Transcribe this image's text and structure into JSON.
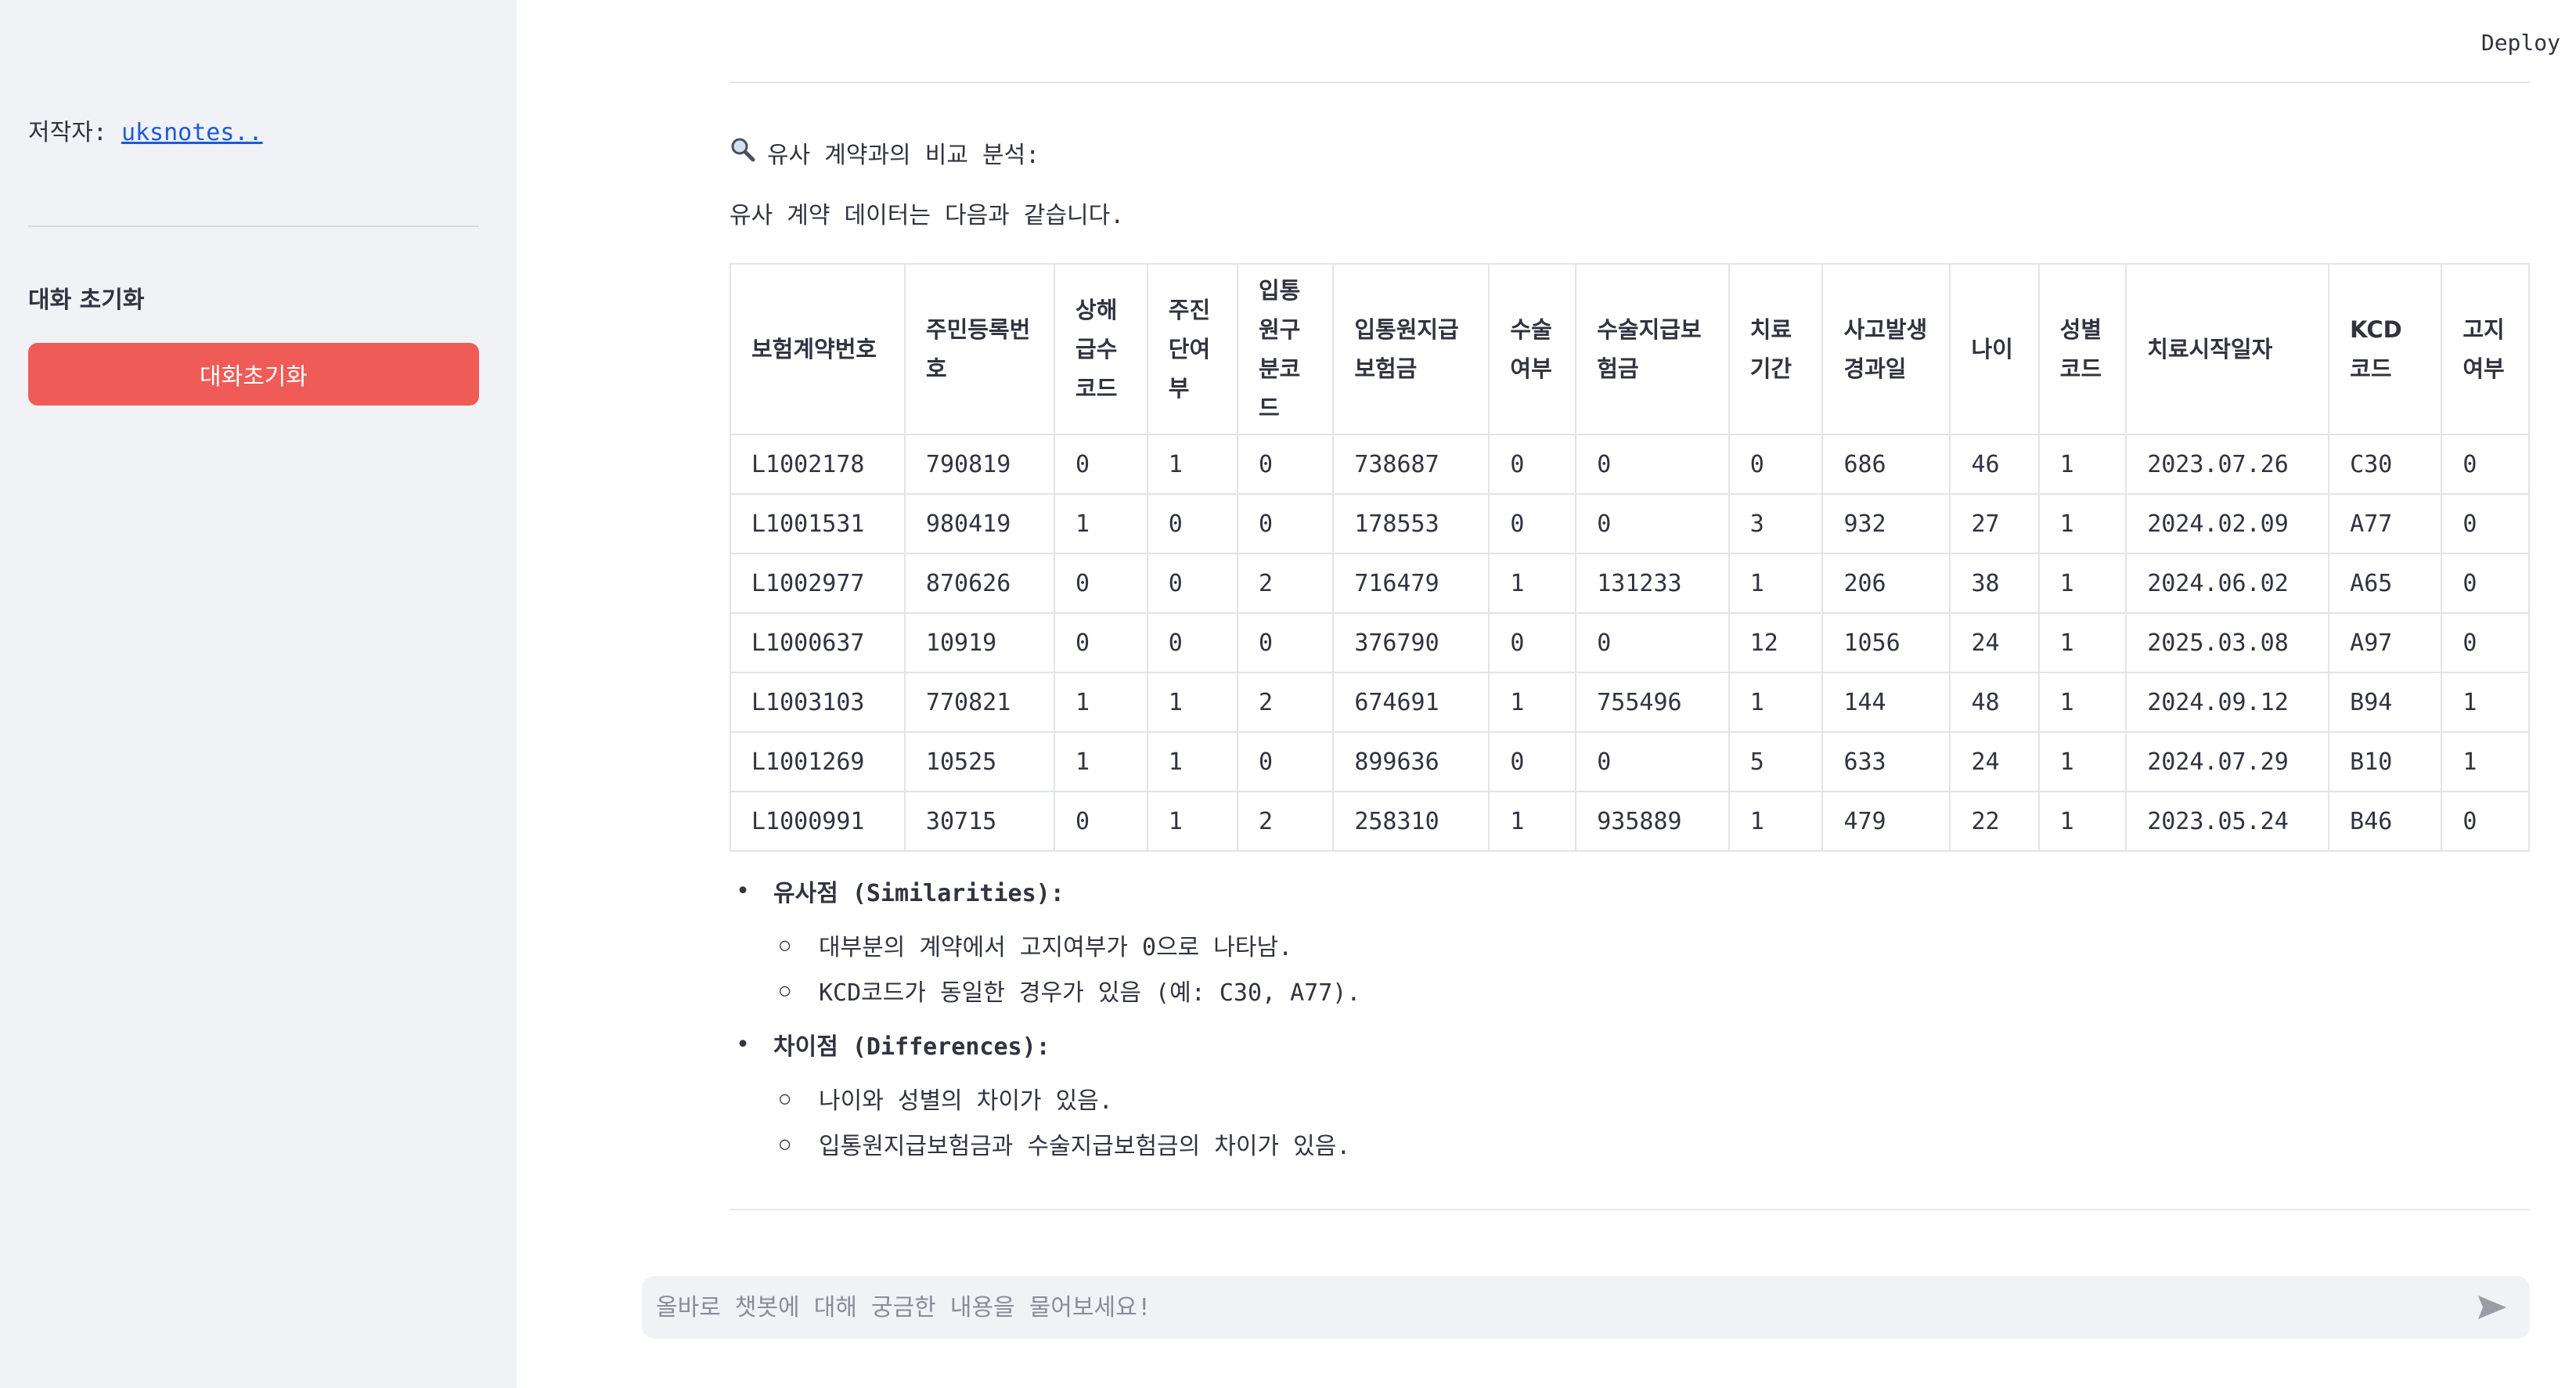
{
  "sidebar": {
    "author_label": "저작자:",
    "author_link": "uksnotes..",
    "reset_heading": "대화 초기화",
    "reset_button": "대화초기화"
  },
  "header": {
    "deploy": "Deploy"
  },
  "main": {
    "analysis_title": "유사 계약과의 비교 분석:",
    "intro": "유사 계약 데이터는 다음과 같습니다.",
    "table": {
      "headers": [
        "보험계약번호",
        "주민등록번호",
        "상해급수코드",
        "주진단여부",
        "입통원구분코드",
        "입통원지급보험금",
        "수술여부",
        "수술지급보험금",
        "치료기간",
        "사고발생경과일",
        "나이",
        "성별코드",
        "치료시작일자",
        "KCD코드",
        "고지여부"
      ],
      "rows": [
        [
          "L1002178",
          "790819",
          "0",
          "1",
          "0",
          "738687",
          "0",
          "0",
          "0",
          "686",
          "46",
          "1",
          "2023.07.26",
          "C30",
          "0"
        ],
        [
          "L1001531",
          "980419",
          "1",
          "0",
          "0",
          "178553",
          "0",
          "0",
          "3",
          "932",
          "27",
          "1",
          "2024.02.09",
          "A77",
          "0"
        ],
        [
          "L1002977",
          "870626",
          "0",
          "0",
          "2",
          "716479",
          "1",
          "131233",
          "1",
          "206",
          "38",
          "1",
          "2024.06.02",
          "A65",
          "0"
        ],
        [
          "L1000637",
          "10919",
          "0",
          "0",
          "0",
          "376790",
          "0",
          "0",
          "12",
          "1056",
          "24",
          "1",
          "2025.03.08",
          "A97",
          "0"
        ],
        [
          "L1003103",
          "770821",
          "1",
          "1",
          "2",
          "674691",
          "1",
          "755496",
          "1",
          "144",
          "48",
          "1",
          "2024.09.12",
          "B94",
          "1"
        ],
        [
          "L1001269",
          "10525",
          "1",
          "1",
          "0",
          "899636",
          "0",
          "0",
          "5",
          "633",
          "24",
          "1",
          "2024.07.29",
          "B10",
          "1"
        ],
        [
          "L1000991",
          "30715",
          "0",
          "1",
          "2",
          "258310",
          "1",
          "935889",
          "1",
          "479",
          "22",
          "1",
          "2023.05.24",
          "B46",
          "0"
        ]
      ]
    },
    "similarities": {
      "title": "유사점 (Similarities):",
      "items": [
        "대부분의 계약에서 고지여부가 0으로 나타남.",
        "KCD코드가 동일한 경우가 있음 (예: C30, A77)."
      ]
    },
    "differences": {
      "title": "차이점 (Differences):",
      "items": [
        "나이와 성별의 차이가 있음.",
        "입통원지급보험금과 수술지급보험금의 차이가 있음."
      ]
    }
  },
  "chat": {
    "placeholder": "올바로 챗봇에 대해 궁금한 내용을 물어보세요!"
  },
  "colors": {
    "primary_button": "#ef5b56",
    "link": "#1c5bd6",
    "sidebar_bg": "#f0f2f6"
  }
}
